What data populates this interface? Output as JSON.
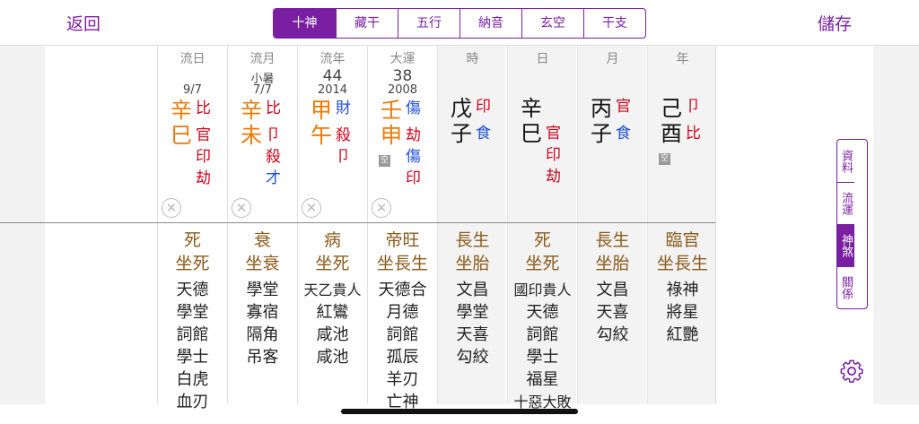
{
  "nav": {
    "back": "返回",
    "save": "儲存"
  },
  "tabs": [
    "十神",
    "藏干",
    "五行",
    "納音",
    "玄空",
    "干支"
  ],
  "active_tab": 0,
  "columns": [
    {
      "label": "流日",
      "sub": "",
      "num": "",
      "date": "9/7",
      "stem": "辛",
      "branch": "巳",
      "stem_god": "比",
      "branch_gods": [
        "官",
        "印",
        "劫"
      ],
      "stem_color": "#f07800",
      "branch_color": "#f07800",
      "kong": false,
      "circle": "✕",
      "life": [
        "死",
        "坐死"
      ],
      "stars": [
        "天德",
        "學堂",
        "詞館",
        "學士",
        "白虎",
        "血刃"
      ]
    },
    {
      "label": "流月",
      "sub": "小暑",
      "num": "",
      "date": "7/7",
      "stem": "辛",
      "branch": "未",
      "stem_god": "比",
      "branch_gods": [
        "卩",
        "殺",
        "才"
      ],
      "stem_color": "#f07800",
      "branch_color": "#f07800",
      "kong": false,
      "circle": "✕",
      "life": [
        "衰",
        "坐衰"
      ],
      "stars": [
        "學堂",
        "寡宿",
        "隔角",
        "吊客"
      ]
    },
    {
      "label": "流年",
      "sub": "",
      "num": "44",
      "date": "2014",
      "stem": "甲",
      "branch": "午",
      "stem_god": "財",
      "branch_gods": [
        "殺",
        "卩"
      ],
      "stem_color": "#f07800",
      "branch_color": "#f07800",
      "kong": false,
      "circle": "✕",
      "life": [
        "病",
        "坐死"
      ],
      "stars": [
        "天乙貴人",
        "紅鸞",
        "咸池",
        "咸池"
      ]
    },
    {
      "label": "大運",
      "sub": "",
      "num": "38",
      "date": "2008",
      "stem": "壬",
      "branch": "申",
      "stem_god": "傷",
      "branch_gods": [
        "劫",
        "傷",
        "印"
      ],
      "stem_color": "#f07800",
      "branch_color": "#f07800",
      "kong": true,
      "circle": "✕",
      "life": [
        "帝旺",
        "坐長生"
      ],
      "stars": [
        "天德合",
        "月德",
        "詞館",
        "孤辰",
        "羊刃",
        "亡神"
      ]
    },
    {
      "label": "時",
      "sub": "",
      "num": "",
      "date": "",
      "stem": "戊",
      "branch": "子",
      "stem_god": "印",
      "branch_gods": [
        "食"
      ],
      "stem_color": "#111",
      "branch_color": "#111",
      "kong": false,
      "circle": "",
      "life": [
        "長生",
        "坐胎"
      ],
      "stars": [
        "文昌",
        "學堂",
        "天喜",
        "勾絞"
      ]
    },
    {
      "label": "日",
      "sub": "",
      "num": "",
      "date": "",
      "stem": "辛",
      "branch": "巳",
      "stem_god": "",
      "branch_gods": [
        "官",
        "印",
        "劫"
      ],
      "stem_color": "#111",
      "branch_color": "#111",
      "kong": false,
      "circle": "",
      "life": [
        "死",
        "坐死"
      ],
      "stars": [
        "國印貴人",
        "天德",
        "詞館",
        "學士",
        "福星",
        "十惡大敗"
      ]
    },
    {
      "label": "月",
      "sub": "",
      "num": "",
      "date": "",
      "stem": "丙",
      "branch": "子",
      "stem_god": "官",
      "branch_gods": [
        "食"
      ],
      "stem_color": "#111",
      "branch_color": "#111",
      "kong": false,
      "circle": "",
      "life": [
        "長生",
        "坐胎"
      ],
      "stars": [
        "文昌",
        "天喜",
        "勾絞"
      ]
    },
    {
      "label": "年",
      "sub": "",
      "num": "",
      "date": "",
      "stem": "己",
      "branch": "酉",
      "stem_god": "卩",
      "branch_gods": [
        "比"
      ],
      "stem_color": "#111",
      "branch_color": "#111",
      "kong": true,
      "circle": "",
      "life": [
        "臨官",
        "坐長生"
      ],
      "stars": [
        "祿神",
        "將星",
        "紅艷"
      ]
    }
  ],
  "kong_label": "空",
  "god_colors": {
    "比": "#d0021b",
    "官": "#d0021b",
    "印": "#d0021b",
    "劫": "#d0021b",
    "卩": "#d0021b",
    "殺": "#d0021b",
    "才": "#1f4fd8",
    "財": "#1f4fd8",
    "傷": "#1f4fd8",
    "食": "#1f4fd8"
  },
  "side_tabs": [
    "資料",
    "流運",
    "神煞",
    "關係"
  ],
  "active_side_tab": 2,
  "settings_icon": "gear-icon",
  "accent_color": "#7b1fa2"
}
